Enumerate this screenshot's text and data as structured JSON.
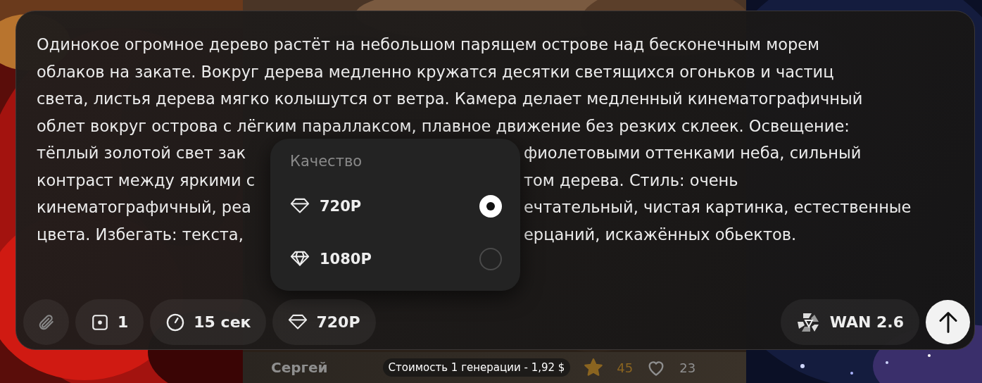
{
  "prompt": {
    "lines": [
      [
        "Одинокое огромное дерево растёт на небольшом парящем острове над бесконечным морем"
      ],
      [
        "облаков на закате. Вокруг дерева медленно кружатся десятки светящихся огоньков и частиц"
      ],
      [
        "света, листья дерева мягко колышутся от ветра. Камера делает медленный кинематографичный"
      ],
      [
        "облет вокруг острова с лёгким параллаксом, плавное движение без резких склеек. Освещение:"
      ],
      [
        "тёплый золотой свет зак",
        "фиолетовыми оттенками неба, сильный"
      ],
      [
        "контраст между яркими с",
        "том дерева. Стиль: очень"
      ],
      [
        "кинематографичный, реа",
        "ечтательный, чистая картинка, естественные"
      ],
      [
        "цвета. Избегать: текста,",
        "ерцаний, искажённых обьектов."
      ]
    ]
  },
  "quality_menu": {
    "title": "Качество",
    "options": [
      {
        "label": "720P",
        "kind": "outline",
        "selected": true
      },
      {
        "label": "1080P",
        "kind": "faceted",
        "selected": false
      }
    ]
  },
  "toolbar": {
    "items": [
      {
        "kind": "attach"
      },
      {
        "kind": "count",
        "label": "1"
      },
      {
        "kind": "duration",
        "label": "15 сек"
      },
      {
        "kind": "quality",
        "label": "720P"
      }
    ],
    "model": {
      "label": "WAN 2.6"
    }
  },
  "card": {
    "author": "Сергей",
    "cost": "Стоимость 1 генерации - 1,92 $",
    "rating_count": "45",
    "likes": "23"
  }
}
